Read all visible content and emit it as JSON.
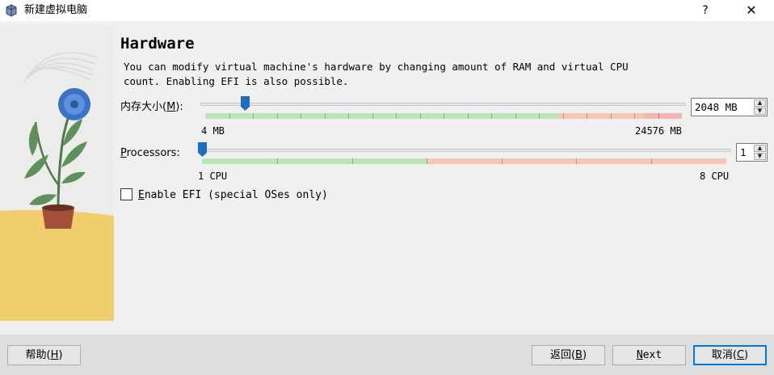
{
  "window": {
    "title": "新建虚拟电脑",
    "help": "?",
    "close": "✕"
  },
  "page": {
    "heading": "Hardware",
    "description": "You can modify virtual machine's hardware by changing amount of RAM and virtual CPU\ncount. Enabling EFI is also possible."
  },
  "memory": {
    "label_prefix": "内存大小(",
    "label_mnemonic": "M",
    "label_suffix": "):",
    "value": "2048 MB",
    "min_label": "4 MB",
    "max_label": "24576 MB",
    "min": 4,
    "max": 24576,
    "current": 2048,
    "colors": {
      "safe": "#b8e6b8",
      "warn": "#f5c6b2",
      "danger": "#f3b4b4"
    }
  },
  "processors": {
    "label_mnemonic": "P",
    "label_rest": "rocessors:",
    "value": "1",
    "min_label": "1 CPU",
    "max_label": "8 CPU",
    "min": 1,
    "max": 8,
    "current": 1
  },
  "efi": {
    "mnemonic": "E",
    "label_rest": "nable EFI (special OSes only)",
    "checked": false
  },
  "buttons": {
    "help_prefix": "帮助(",
    "help_mnemonic": "H",
    "help_suffix": ")",
    "back_prefix": "返回(",
    "back_mnemonic": "B",
    "back_suffix": ")",
    "next_mnemonic": "N",
    "next_rest": "ext",
    "cancel_prefix": "取消(",
    "cancel_mnemonic": "C",
    "cancel_suffix": ")"
  },
  "colors": {
    "accent": "#0078d7",
    "thumb": "#1f6fbf"
  }
}
